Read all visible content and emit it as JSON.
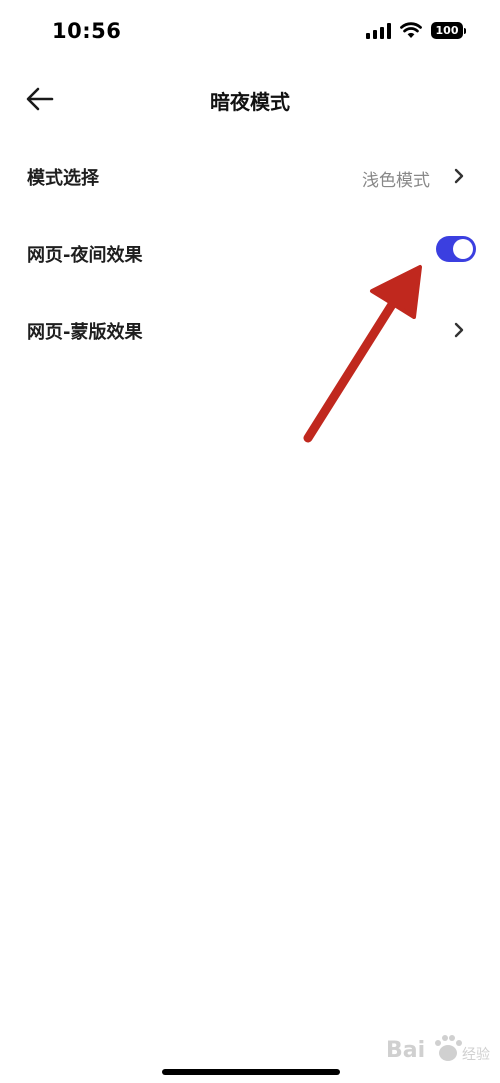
{
  "status_bar": {
    "time": "10:56",
    "battery_level": "100"
  },
  "nav": {
    "back_icon": "arrow-left-icon",
    "title": "暗夜模式"
  },
  "settings": {
    "mode_select": {
      "label": "模式选择",
      "value": "浅色模式",
      "icon": "chevron-right-icon"
    },
    "night_effect": {
      "label": "网页-夜间效果",
      "toggle_on": true,
      "toggle_color": "#3b3fe0"
    },
    "mask_effect": {
      "label": "网页-蒙版效果",
      "icon": "chevron-right-icon"
    }
  },
  "annotation": {
    "arrow_color": "#c0281e"
  },
  "watermark": {
    "text": "Baidu经验"
  }
}
